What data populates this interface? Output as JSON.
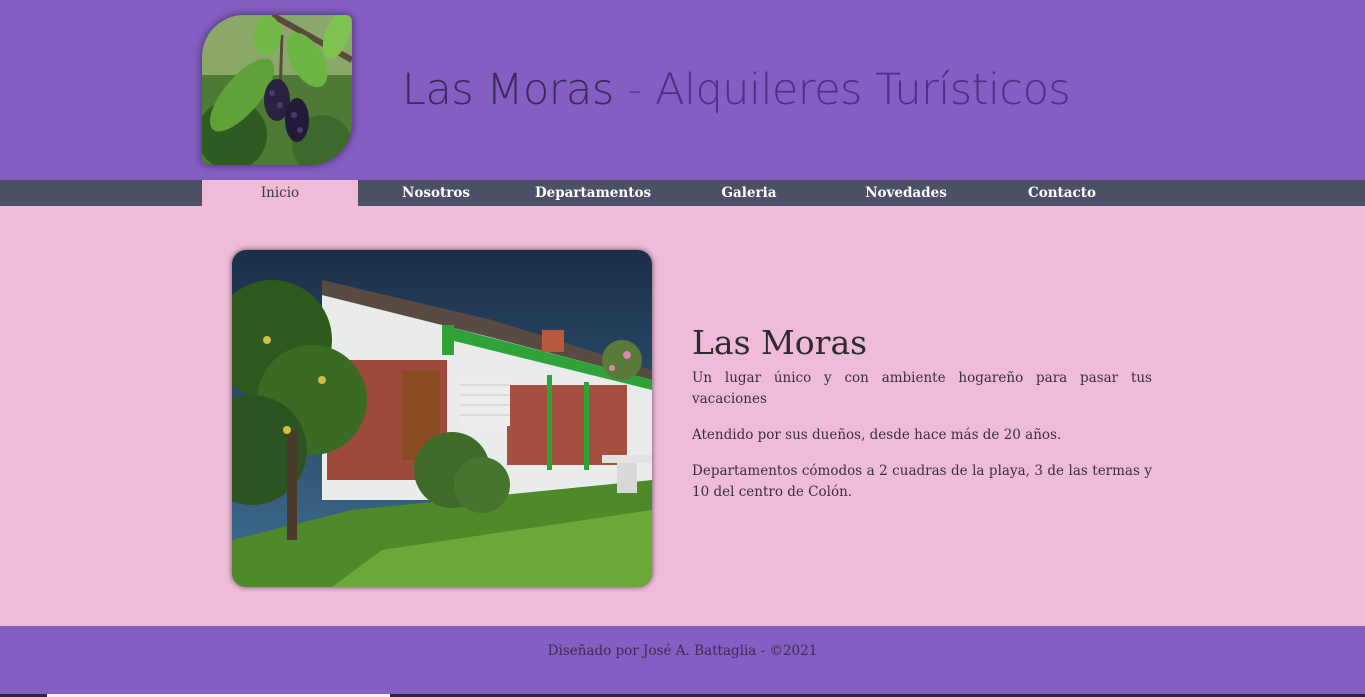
{
  "header": {
    "site_name": "Las Moras",
    "separator": "-",
    "tagline": "Alquileres Turísticos",
    "logo_icon": "mulberry-branch-logo"
  },
  "nav": {
    "items": [
      {
        "label": "Inicio",
        "active": true
      },
      {
        "label": "Nosotros",
        "active": false
      },
      {
        "label": "Departamentos",
        "active": false
      },
      {
        "label": "Galeria",
        "active": false
      },
      {
        "label": "Novedades",
        "active": false
      },
      {
        "label": "Contacto",
        "active": false
      }
    ]
  },
  "main": {
    "photo_icon": "house-photo",
    "title": "Las Moras",
    "paragraphs": [
      "Un lugar único y con ambiente hogareño para pasar tus vacaciones",
      "Atendido por sus dueños, desde hace más de 20 años.",
      "Departamentos cómodos a 2 cuadras de la playa, 3 de las termas y 10 del centro de Colón."
    ]
  },
  "footer": {
    "text": "Diseñado por José A. Battaglia - ©2021"
  },
  "colors": {
    "header_bg": "#845ec2",
    "nav_bg": "#4b5066",
    "page_bg": "#eebcd8",
    "footer_bg": "#845ec2"
  }
}
